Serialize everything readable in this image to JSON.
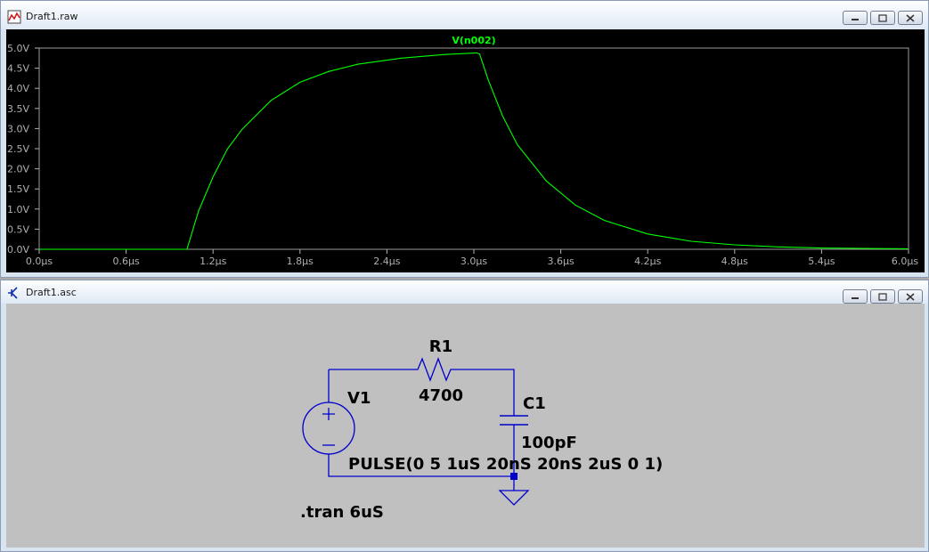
{
  "waveform_window": {
    "title": "Draft1.raw",
    "icon": "waveform-icon",
    "trace_label": "V(n002)",
    "trace_color": "#00ff00",
    "y_ticks": [
      "0.0V",
      "0.5V",
      "1.0V",
      "1.5V",
      "2.0V",
      "2.5V",
      "3.0V",
      "3.5V",
      "4.0V",
      "4.5V",
      "5.0V"
    ],
    "x_ticks": [
      "0.0µs",
      "0.6µs",
      "1.2µs",
      "1.8µs",
      "2.4µs",
      "3.0µs",
      "3.6µs",
      "4.2µs",
      "4.8µs",
      "5.4µs",
      "6.0µs"
    ]
  },
  "chart_data": {
    "type": "line",
    "title": "",
    "xlabel": "",
    "ylabel": "",
    "xlim": [
      0,
      6
    ],
    "ylim": [
      0,
      5
    ],
    "x_unit": "µs",
    "y_unit": "V",
    "series": [
      {
        "name": "V(n002)",
        "x": [
          0,
          1.0,
          1.02,
          1.1,
          1.2,
          1.3,
          1.4,
          1.6,
          1.8,
          2.0,
          2.2,
          2.5,
          2.8,
          3.02,
          3.04,
          3.1,
          3.2,
          3.3,
          3.5,
          3.7,
          3.9,
          4.2,
          4.5,
          4.8,
          5.1,
          5.4,
          5.7,
          6.0
        ],
        "y": [
          0,
          0,
          0,
          0.95,
          1.8,
          2.5,
          2.98,
          3.7,
          4.15,
          4.42,
          4.6,
          4.75,
          4.84,
          4.88,
          4.85,
          4.2,
          3.3,
          2.6,
          1.7,
          1.1,
          0.72,
          0.38,
          0.2,
          0.11,
          0.06,
          0.03,
          0.02,
          0.01
        ]
      }
    ]
  },
  "schematic_window": {
    "title": "Draft1.asc",
    "icon": "schematic-icon",
    "v1_label": "V1",
    "r1_label": "R1",
    "r1_value": "4700",
    "c1_label": "C1",
    "c1_value": "100pF",
    "source_value": "PULSE(0 5 1uS 20nS 20nS 2uS 0 1)",
    "directive": ".tran 6uS",
    "wire_color": "#0000cc"
  }
}
